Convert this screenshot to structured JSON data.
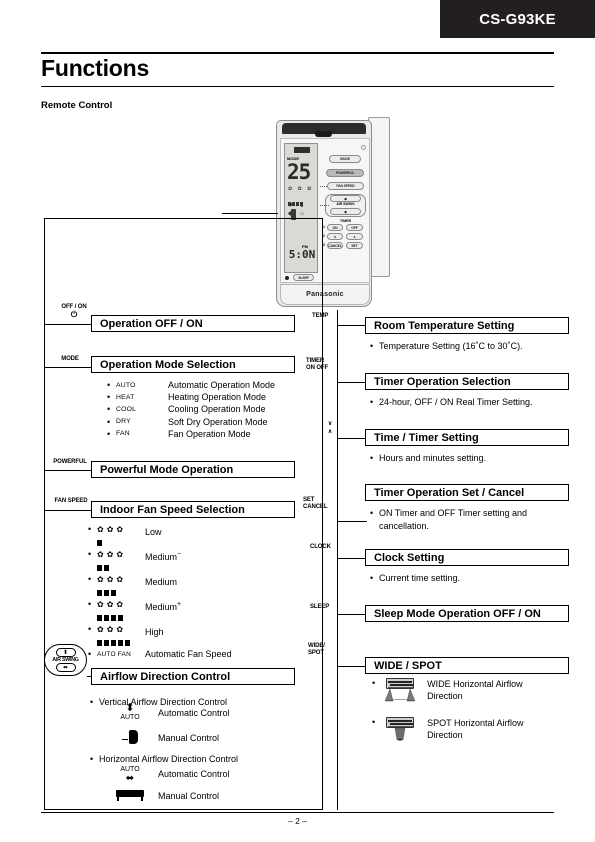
{
  "header": {
    "model": "CS-G93KE",
    "title": "Functions",
    "section_label": "Remote Control"
  },
  "remote": {
    "brand": "Panasonic",
    "lcd": {
      "badge_icon": "auto-badge",
      "mode_label": "MODE",
      "temperature": "25",
      "ampm": "PM",
      "time": "5:0N",
      "fan_icons": "✿ ✿ ✿",
      "swing_icons": "◆ ▮",
      "extra_icons": "◆ ⌂"
    },
    "buttons": [
      {
        "name": "mode-button",
        "label": "MODE"
      },
      {
        "name": "powerful-button",
        "label": "POWERFUL"
      },
      {
        "name": "fan-speed-button",
        "label": "FAN SPEED"
      },
      {
        "name": "air-swing-vertical-button",
        "label": "◆"
      },
      {
        "name": "air-swing-label",
        "label": "AIR SWING"
      },
      {
        "name": "air-swing-horizontal-button",
        "label": "◆"
      },
      {
        "name": "timer-caption",
        "label": "TIMER"
      },
      {
        "name": "timer-on-button",
        "label": "ON"
      },
      {
        "name": "timer-off-button",
        "label": "OFF"
      },
      {
        "name": "timer-down-button",
        "label": "∨"
      },
      {
        "name": "timer-up-button",
        "label": "∧"
      },
      {
        "name": "cancel-button",
        "label": "CANCEL"
      },
      {
        "name": "set-button",
        "label": "SET"
      },
      {
        "name": "sleep-button",
        "label": "SLEEP"
      }
    ]
  },
  "left_column": {
    "items": [
      {
        "key": "OFF / ON",
        "key_symbol": "⏻",
        "heading": "Operation OFF / ON",
        "details": []
      },
      {
        "key": "MODE",
        "heading": "Operation Mode Selection",
        "modes": [
          {
            "code": "AUTO",
            "inverted": true,
            "desc": "Automatic Operation Mode"
          },
          {
            "code": "HEAT",
            "inverted": false,
            "desc": "Heating Operation Mode"
          },
          {
            "code": "COOL",
            "inverted": false,
            "desc": "Cooling Operation Mode"
          },
          {
            "code": "DRY",
            "inverted": false,
            "desc": "Soft Dry Operation Mode"
          },
          {
            "code": "FAN",
            "inverted": false,
            "desc": "Fan Operation Mode"
          }
        ]
      },
      {
        "key": "POWERFUL",
        "heading": "Powerful Mode Operation",
        "details": []
      },
      {
        "key": "FAN SPEED",
        "heading": "Indoor Fan Speed Selection",
        "speeds": [
          {
            "label": "Low",
            "suffix": "",
            "bars": 1
          },
          {
            "label": "Medium",
            "suffix": "−",
            "bars": 2
          },
          {
            "label": "Medium",
            "suffix": "",
            "bars": 3
          },
          {
            "label": "Medium",
            "suffix": "+",
            "bars": 4
          },
          {
            "label": "High",
            "suffix": "",
            "bars": 5
          }
        ],
        "auto_code": "AUTO FAN",
        "auto_desc": "Automatic Fan Speed"
      },
      {
        "key": "AIR SWING",
        "heading": "Airflow Direction Control",
        "vertical_title": "Vertical Airflow Direction Control",
        "vertical_auto_label": "AUTO",
        "vertical_auto_desc": "Automatic Control",
        "vertical_manual_desc": "Manual Control",
        "horizontal_title": "Horizontal Airflow Direction Control",
        "horizontal_auto_label": "AUTO",
        "horizontal_auto_desc": "Automatic Control",
        "horizontal_manual_desc": "Manual Control"
      }
    ]
  },
  "right_column": {
    "items": [
      {
        "key": "TEMP",
        "heading": "Room Temperature Setting",
        "bullet": "Temperature Setting (16˚C to 30˚C)."
      },
      {
        "key": "TIMER\nON OFF",
        "heading": "Timer Operation Selection",
        "bullet": "24-hour, OFF / ON Real Timer Setting."
      },
      {
        "key": "∨\n∧",
        "heading": "Time / Timer Setting",
        "bullet": "Hours and minutes setting."
      },
      {
        "key": "SET\nCANCEL",
        "heading": "Timer Operation Set / Cancel",
        "bullet": "ON Timer and OFF Timer setting and cancellation."
      },
      {
        "key": "CLOCK",
        "heading": "Clock Setting",
        "bullet": "Current time setting."
      },
      {
        "key": "SLEEP",
        "heading": "Sleep Mode Operation OFF / ON",
        "bullet": ""
      },
      {
        "key": "WIDE/\nSPOT",
        "heading": "WIDE / SPOT",
        "wide_desc": "WIDE Horizontal Airflow Direction",
        "spot_desc": "SPOT Horizontal Airflow Direction"
      }
    ]
  },
  "footer": {
    "folio": "– 2 –"
  },
  "colors": {
    "tag_bg": "#231f20",
    "ink": "#000000",
    "lcd": "#d8dbd4"
  }
}
